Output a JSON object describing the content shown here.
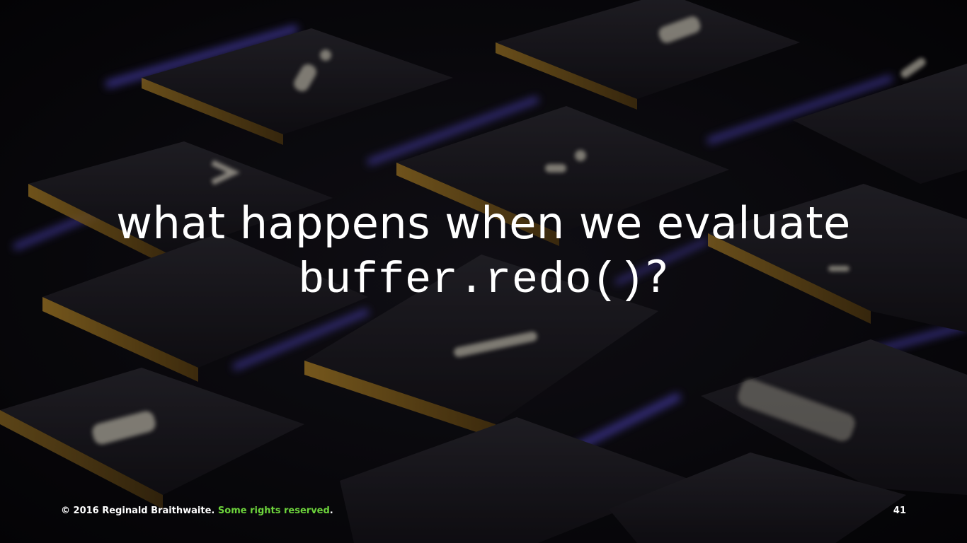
{
  "slide": {
    "title_line1": "what happens when we evaluate",
    "title_code": "buffer.redo()",
    "title_suffix": "?",
    "footer": {
      "copyright": "© 2016 Reginald Braithwaite.",
      "rights_link": "Some rights reserved",
      "period": ".",
      "page_number": "41"
    }
  },
  "colors": {
    "text": "#ffffff",
    "link": "#6dd43c",
    "backlight": "#6a5cff",
    "key_edge": "#c8952a"
  },
  "background_image": "keyboard-backlit-keys"
}
